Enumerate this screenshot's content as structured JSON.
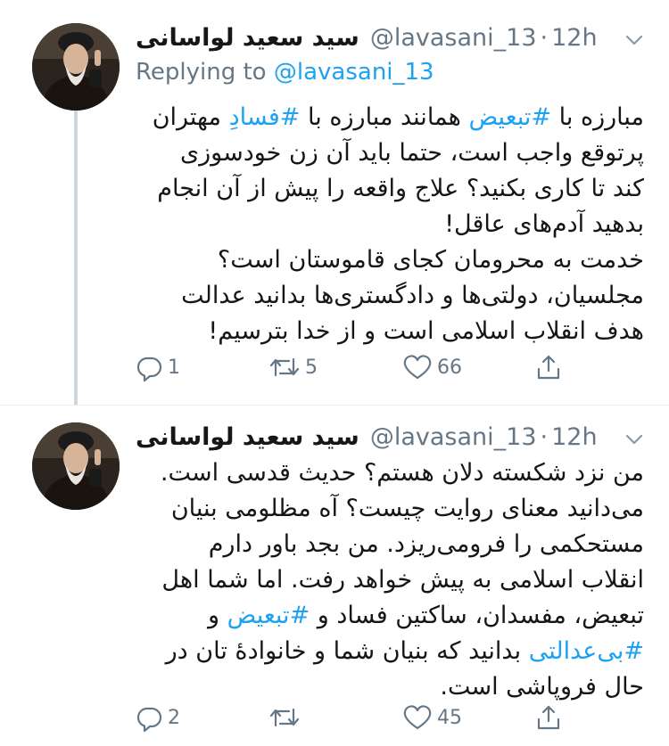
{
  "tweets": [
    {
      "name": "سید سعید لواسانی",
      "handle": "@lavasani_13",
      "separator": "·",
      "time": "12h",
      "replying_prefix": "Replying to ",
      "replying_handle": "@lavasani_13",
      "body": {
        "l1a": "مبارزه با ",
        "l1tag1": "#تبعیض",
        "l1b": " همانند مبارزه با ",
        "l1tag2": "#فسادِ",
        "l1c": " مهتران",
        "l2": "پرتوقع واجب است، حتما باید آن زن خودسوزی",
        "l3": "کند تا کاری بکنید؟ علاج واقعه را پیش از آن انجام",
        "l4": "بدهید آدم‌های عاقل!",
        "l5": "خدمت به محرومان کجای قاموستان است؟",
        "l6": "مجلسیان، دولتی‌ها و دادگستری‌ها بدانید عدالت",
        "l7": "هدف انقلاب اسلامی است و از خدا بترسیم!"
      },
      "actions": {
        "replies": "1",
        "retweets": "5",
        "likes": "66"
      }
    },
    {
      "name": "سید سعید لواسانی",
      "handle": "@lavasani_13",
      "separator": "·",
      "time": "12h",
      "body": {
        "l1": "من نزد شکسته دلان هستم؟ حدیث قدسی است.",
        "l2": "می‌دانید معنای روایت چیست؟ آه مظلومی بنیان",
        "l3": "مستحکمی را فرومی‌ریزد. من بجد باور دارم",
        "l4": "انقلاب اسلامی به پیش خواهد رفت. اما شما اهل",
        "l5a": "تبعیض، مفسدان، ساکتین فساد و ",
        "l5tag": "#تبعیض",
        "l5b": " و",
        "l6tag": "#بی‌عدالتی",
        "l6b": " بدانید که بنیان شما و خانوادهٔ تان در",
        "l7": "حال فروپاشی است."
      },
      "actions": {
        "replies": "2",
        "retweets": "",
        "likes": "45"
      }
    }
  ],
  "colors": {
    "link": "#1da1f2",
    "muted": "#657786",
    "text": "#14171a",
    "thread_line": "#ccd6dd"
  },
  "icons": [
    "profile-photo",
    "chevron-down-icon",
    "reply-icon",
    "retweet-icon",
    "like-icon",
    "share-icon"
  ]
}
